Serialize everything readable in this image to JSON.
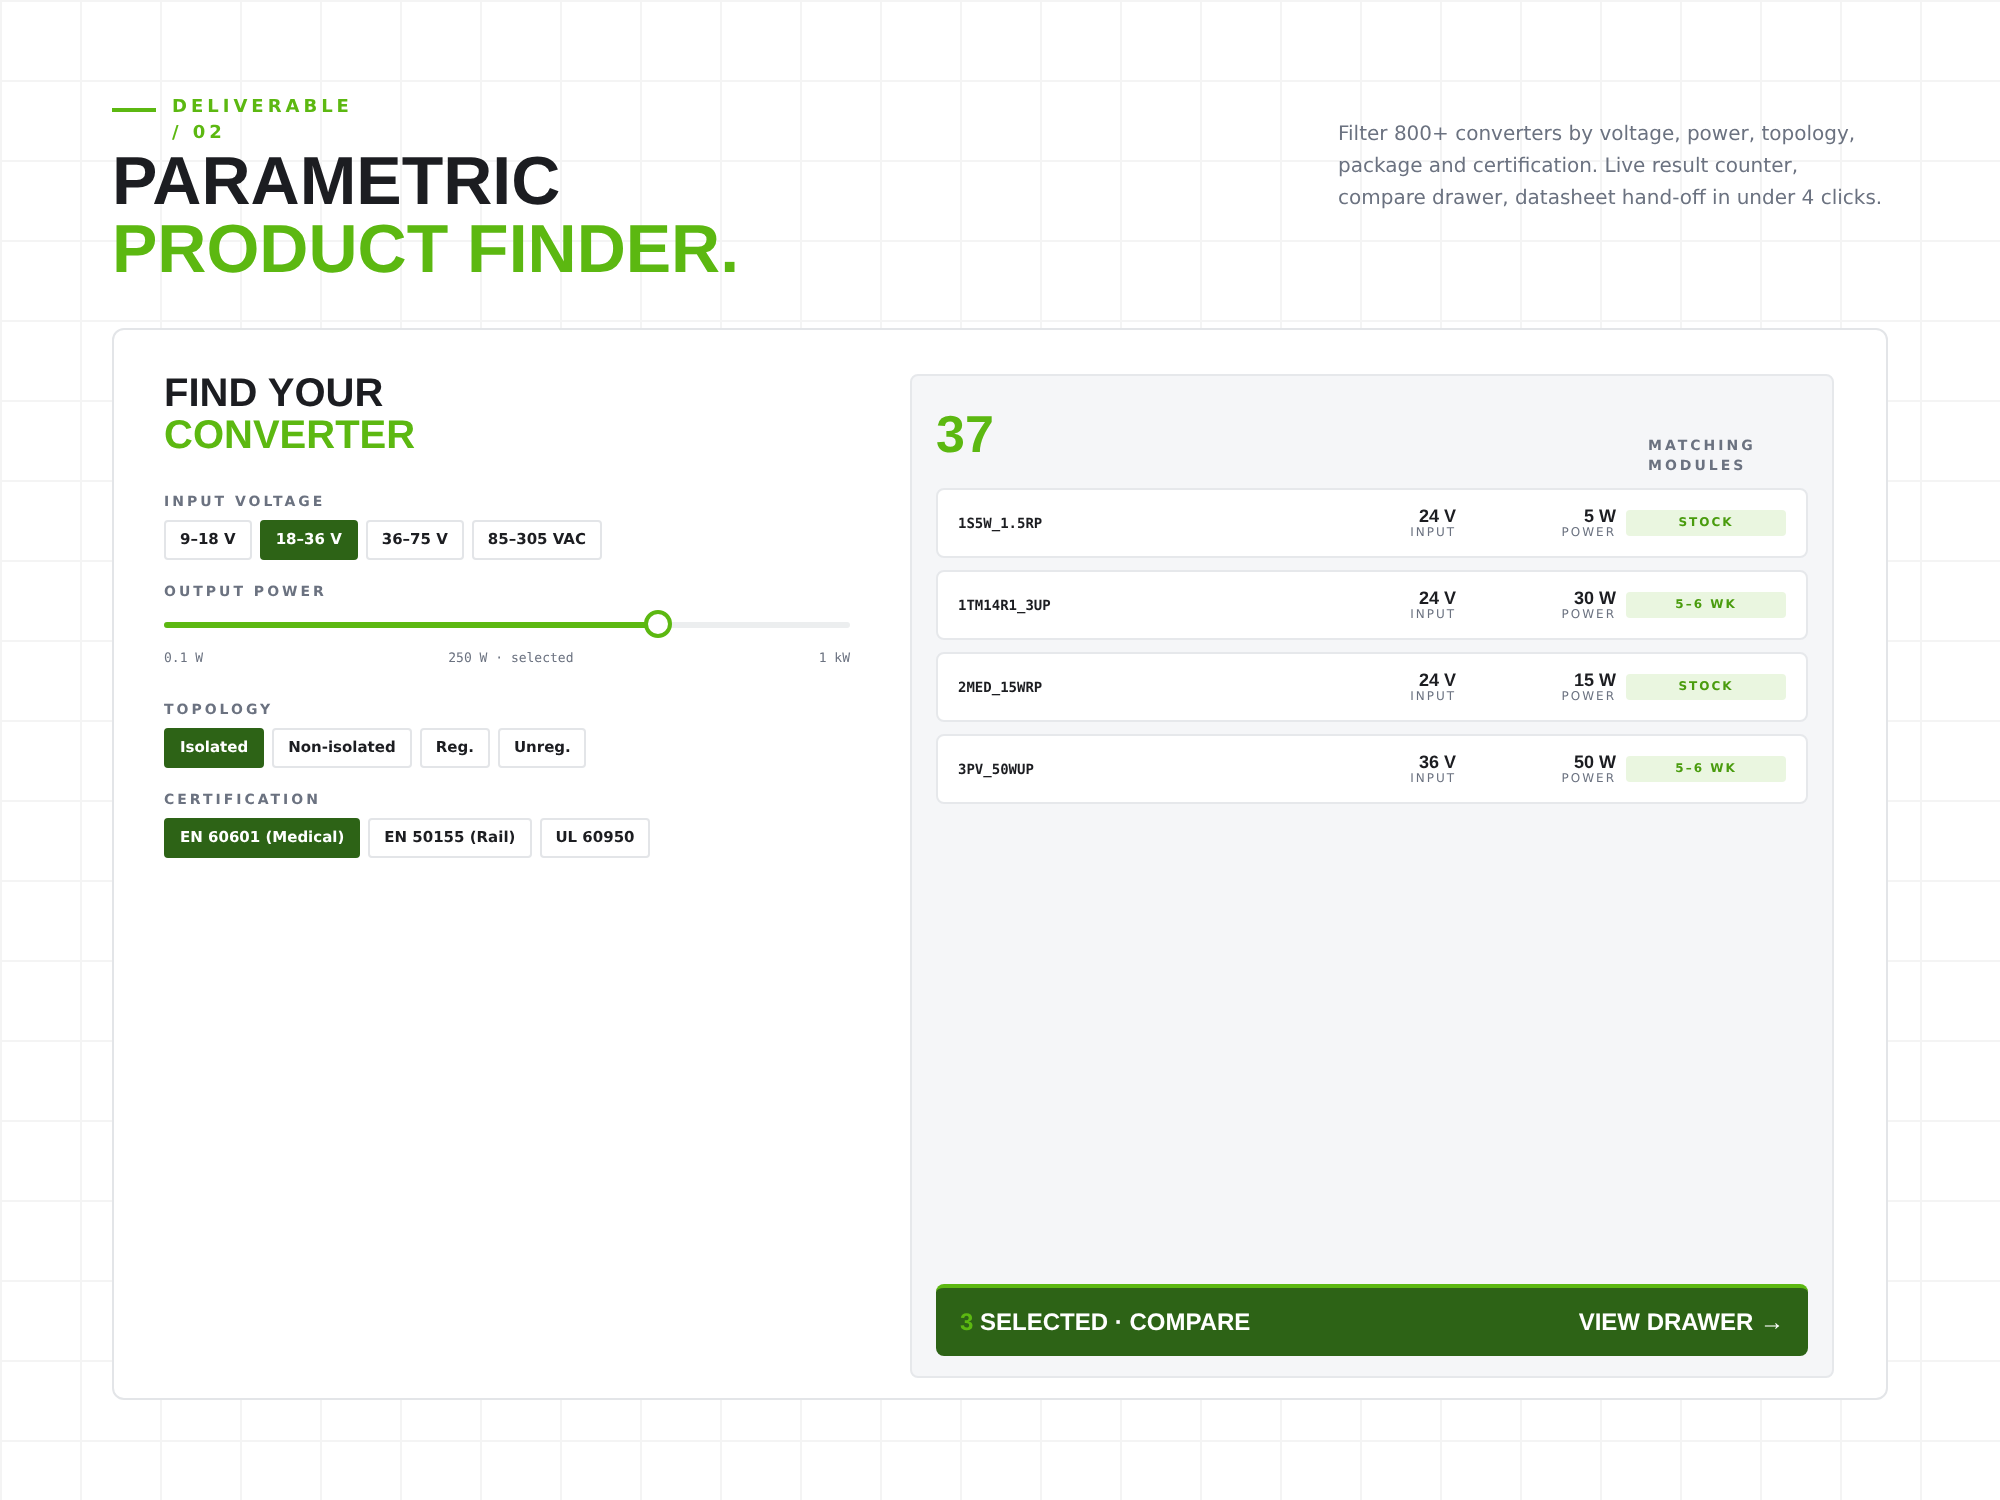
{
  "header": {
    "eyebrow": "DELIVERABLE / 02",
    "title_line1": "PARAMETRIC",
    "title_line2": "PRODUCT FINDER.",
    "description": "Filter 800+ converters by voltage, power, topology, package and certification. Live result counter, compare drawer, datasheet hand-off in under 4 clicks."
  },
  "finder": {
    "title_line1": "FIND YOUR",
    "title_line2": "CONVERTER",
    "input_voltage": {
      "label": "INPUT VOLTAGE",
      "options": [
        {
          "label": "9–18 V",
          "selected": false
        },
        {
          "label": "18–36 V",
          "selected": true
        },
        {
          "label": "36–75 V",
          "selected": false
        },
        {
          "label": "85–305 VAC",
          "selected": false
        }
      ]
    },
    "output_power": {
      "label": "OUTPUT POWER",
      "level": 0.72,
      "min": "0.1 W",
      "reading": "250 W · selected",
      "max": "1 kW"
    },
    "topology": {
      "label": "TOPOLOGY",
      "options": [
        {
          "label": "Isolated",
          "selected": true
        },
        {
          "label": "Non-isolated",
          "selected": false
        },
        {
          "label": "Reg.",
          "selected": false
        },
        {
          "label": "Unreg.",
          "selected": false
        }
      ]
    },
    "certification": {
      "label": "CERTIFICATION",
      "options": [
        {
          "label": "EN 60601 (Medical)",
          "selected": true
        },
        {
          "label": "EN 50155 (Rail)",
          "selected": false
        },
        {
          "label": "UL 60950",
          "selected": false
        }
      ]
    }
  },
  "results": {
    "count": "37",
    "count_label": "MATCHING MODULES",
    "rows": [
      {
        "part": "1S5W_1.5RP",
        "input": "24 V",
        "input_label": "INPUT",
        "power": "5 W",
        "power_label": "POWER",
        "availability": "STOCK"
      },
      {
        "part": "1TM14R1_3UP",
        "input": "24 V",
        "input_label": "INPUT",
        "power": "30 W",
        "power_label": "POWER",
        "availability": "5–6 WK"
      },
      {
        "part": "2MED_15WRP",
        "input": "24 V",
        "input_label": "INPUT",
        "power": "15 W",
        "power_label": "POWER",
        "availability": "STOCK"
      },
      {
        "part": "3PV_50WUP",
        "input": "36 V",
        "input_label": "INPUT",
        "power": "50 W",
        "power_label": "POWER",
        "availability": "5–6 WK"
      }
    ],
    "drawer": {
      "selected_count": "3",
      "selected_text": "SELECTED · COMPARE",
      "action": "VIEW DRAWER →"
    }
  }
}
